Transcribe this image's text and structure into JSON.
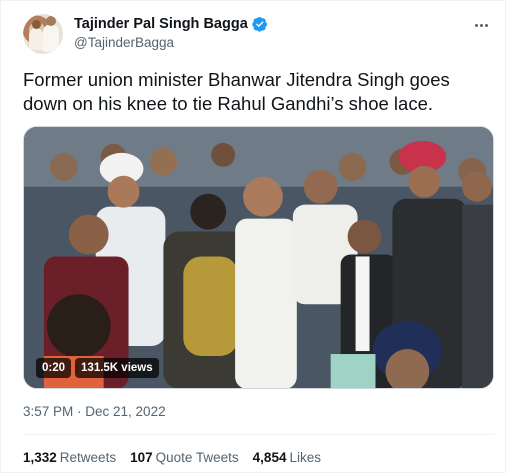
{
  "author": {
    "display_name": "Tajinder Pal Singh Bagga",
    "handle": "@TajinderBagga",
    "verified": true,
    "verified_color": "#1d9bf0"
  },
  "tweet": {
    "text": "Former union minister Bhanwar Jitendra Singh goes down on his knee to tie Rahul Gandhi’s shoe lace.",
    "timestamp": "3:57 PM · Dec 21, 2022"
  },
  "video": {
    "duration": "0:20",
    "views": "131.5K views"
  },
  "stats": {
    "retweets_count": "1,332",
    "retweets_label": "Retweets",
    "quote_count": "107",
    "quote_label": "Quote Tweets",
    "likes_count": "4,854",
    "likes_label": "Likes"
  },
  "icons": {
    "more": "more-icon",
    "verified": "verified-badge-icon"
  }
}
